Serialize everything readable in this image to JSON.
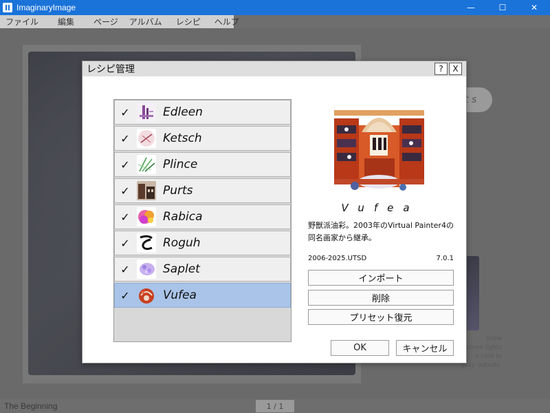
{
  "window": {
    "title": "ImaginaryImage",
    "controls": [
      "—",
      "☐",
      "✕"
    ]
  },
  "menubar": [
    "ファイル",
    "編集",
    "ページ",
    "アルバム",
    "レシピ",
    "ヘルプ"
  ],
  "background": {
    "pill_text": "t s",
    "side_text": "snow\nstove lights\no cold to\nplay outside."
  },
  "statusbar": {
    "title": "The Beginning",
    "page": "1 / 1"
  },
  "dialog": {
    "title": "レシピ管理",
    "help_label": "?",
    "close_label": "X",
    "items": [
      {
        "label": "Edleen",
        "checked": true,
        "selected": false,
        "icon": "edleen-icon"
      },
      {
        "label": "Ketsch",
        "checked": true,
        "selected": false,
        "icon": "ketsch-icon"
      },
      {
        "label": "Plince",
        "checked": true,
        "selected": false,
        "icon": "plince-icon"
      },
      {
        "label": "Purts",
        "checked": true,
        "selected": false,
        "icon": "purts-icon"
      },
      {
        "label": "Rabica",
        "checked": true,
        "selected": false,
        "icon": "rabica-icon"
      },
      {
        "label": "Roguh",
        "checked": true,
        "selected": false,
        "icon": "roguh-icon"
      },
      {
        "label": "Saplet",
        "checked": true,
        "selected": false,
        "icon": "saplet-icon"
      },
      {
        "label": "Vufea",
        "checked": true,
        "selected": true,
        "icon": "vufea-icon"
      }
    ],
    "check_glyph": "✓",
    "detail": {
      "name": "Vufea",
      "description": "野獣派油彩。2003年のVirtual Painter4の同名画家から継承。",
      "copyright": "2006-2025.UTSD",
      "version": "7.0.1"
    },
    "buttons": {
      "import": "インポート",
      "delete": "削除",
      "restore": "プリセット復元",
      "ok": "OK",
      "cancel": "キャンセル"
    }
  }
}
